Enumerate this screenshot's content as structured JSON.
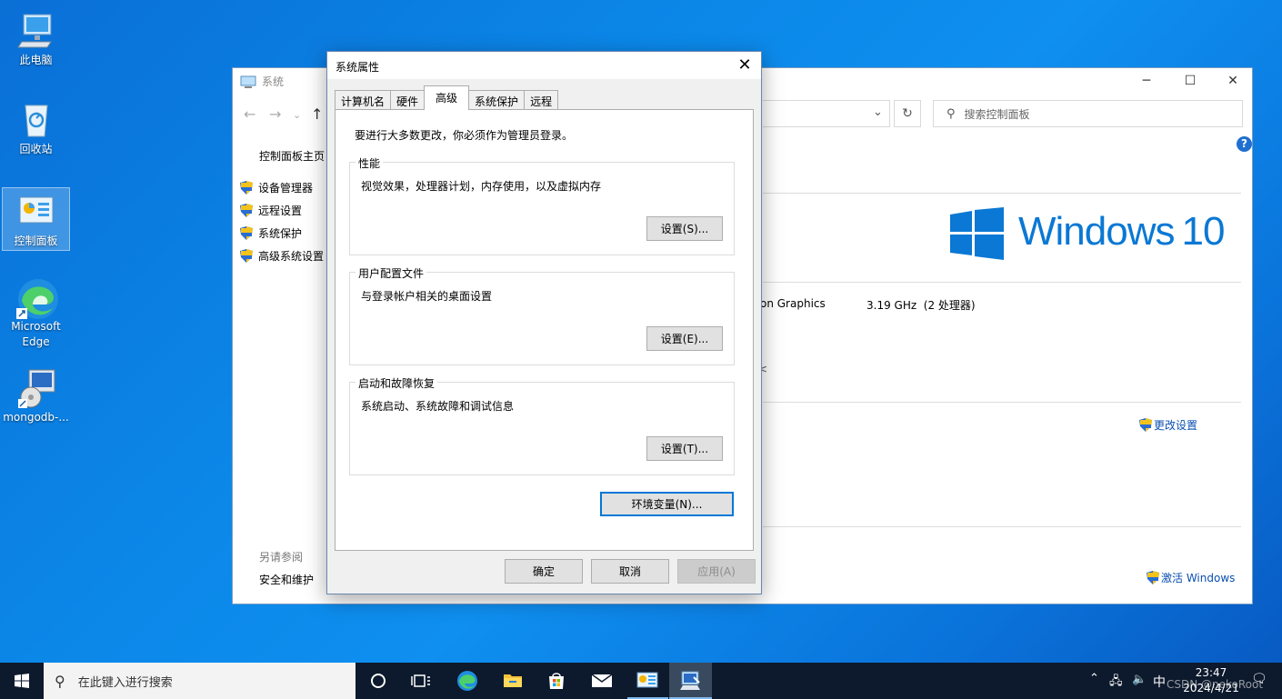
{
  "desktop": {
    "icons": [
      {
        "label": "此电脑"
      },
      {
        "label": "回收站"
      },
      {
        "label": "控制面板"
      },
      {
        "label": "Microsoft Edge"
      },
      {
        "label": "mongodb-..."
      }
    ]
  },
  "control_panel": {
    "title": "系统",
    "search_placeholder": "搜索控制面板",
    "side_home": "控制面板主页",
    "side_items": [
      "设备管理器",
      "远程设置",
      "系统保护",
      "高级系统设置"
    ],
    "see_also_title": "另请参阅",
    "see_also_items": [
      "安全和维护"
    ],
    "windows_brand": "Windows",
    "windows_version": "10",
    "cpu_fragment": "on Graphics",
    "cpu_speed": "3.19 GHz  (2 处理器)",
    "change_settings": "更改设置",
    "activate_windows": "激活 Windows",
    "partial_char": "<"
  },
  "dialog": {
    "title": "系统属性",
    "tabs": [
      "计算机名",
      "硬件",
      "高级",
      "系统保护",
      "远程"
    ],
    "active_tab": "高级",
    "admin_notice": "要进行大多数更改，你必须作为管理员登录。",
    "groups": [
      {
        "legend": "性能",
        "desc": "视觉效果，处理器计划，内存使用，以及虚拟内存",
        "button": "设置(S)..."
      },
      {
        "legend": "用户配置文件",
        "desc": "与登录帐户相关的桌面设置",
        "button": "设置(E)..."
      },
      {
        "legend": "启动和故障恢复",
        "desc": "系统启动、系统故障和调试信息",
        "button": "设置(T)..."
      }
    ],
    "env_button": "环境变量(N)...",
    "ok": "确定",
    "cancel": "取消",
    "apply": "应用(A)"
  },
  "taskbar": {
    "search_placeholder": "在此键入进行搜索",
    "ime": "中",
    "time": "23:47",
    "date": "2024/4/21",
    "watermark": "CSDN @nekoRoot"
  },
  "colors": {
    "accent": "#0078d7",
    "windows_blue": "#0a78d4",
    "desktop": "#0b87e8"
  }
}
